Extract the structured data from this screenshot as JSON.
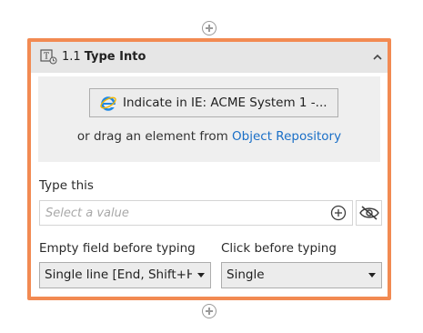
{
  "activity": {
    "number": "1.1",
    "name": "Type Into",
    "icon": "type-into-icon",
    "accent_color": "#f28a52"
  },
  "indicate": {
    "button_label": "Indicate in IE: ACME System 1 -...",
    "icon": "internet-explorer-icon",
    "drag_prefix": "or drag an element from",
    "repo_link": "Object Repository"
  },
  "type_this": {
    "label": "Type this",
    "placeholder": "Select a value"
  },
  "empty_field": {
    "label": "Empty field before typing",
    "value": "Single line [End, Shift+H"
  },
  "click_before": {
    "label": "Click before typing",
    "value": "Single"
  }
}
